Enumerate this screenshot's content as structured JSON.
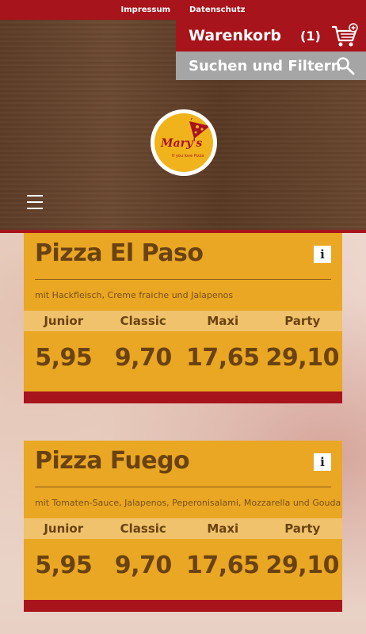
{
  "topbar": {
    "links": [
      "Impressum",
      "Datenschutz"
    ]
  },
  "cart": {
    "label": "Warenkorb",
    "count": "(1)",
    "icon": "cart-icon"
  },
  "search": {
    "label": "Suchen und Filtern",
    "icon": "search-icon"
  },
  "logo": {
    "name": "Mary's",
    "tagline": "If you love Pizza"
  },
  "menu_icon": "hamburger-icon",
  "sizes": [
    "Junior",
    "Classic",
    "Maxi",
    "Party"
  ],
  "pizzas": [
    {
      "name": "Pizza El Paso",
      "description": "mit Hackfleisch, Creme fraiche und Jalapenos",
      "prices": [
        "5,95",
        "9,70",
        "17,65",
        "29,10"
      ],
      "info": "i"
    },
    {
      "name": "Pizza Fuego",
      "description": "mit Tomaten-Sauce, Jalapenos, Peperonisalami, Mozzarella und Gouda",
      "prices": [
        "5,95",
        "9,70",
        "17,65",
        "29,10"
      ],
      "info": "i"
    }
  ],
  "colors": {
    "brand_red": "#a8141b",
    "card": "#e9a723",
    "text_brown": "#6a4212",
    "search_grey": "#a5a5a5"
  }
}
